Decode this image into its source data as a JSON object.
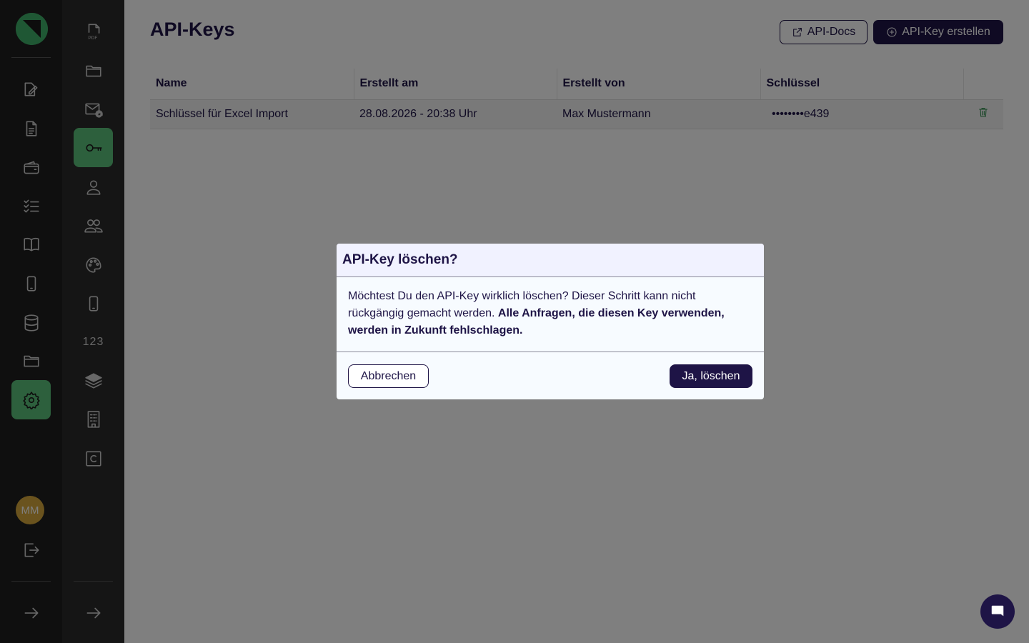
{
  "page": {
    "title": "API-Keys"
  },
  "header": {
    "docs_label": "API-Docs",
    "create_label": "API-Key erstellen"
  },
  "table": {
    "columns": [
      "Name",
      "Erstellt am",
      "Erstellt von",
      "Schlüssel"
    ],
    "rows": [
      {
        "name": "Schlüssel für Excel Import",
        "created_at": "28.08.2026 - 20:38 Uhr",
        "created_by": "Max Mustermann",
        "key": "••••••••e439"
      }
    ]
  },
  "sidebar": {
    "primary": [
      {
        "icon": "edit-document-icon"
      },
      {
        "icon": "document-icon"
      },
      {
        "icon": "wallet-icon"
      },
      {
        "icon": "checklist-icon"
      },
      {
        "icon": "book-icon"
      },
      {
        "icon": "phone-icon"
      },
      {
        "icon": "database-icon"
      },
      {
        "icon": "folder-icon"
      },
      {
        "icon": "settings-icon",
        "active": true
      }
    ],
    "secondary": [
      {
        "icon": "pdf-icon",
        "label": "PDF"
      },
      {
        "icon": "folder-icon"
      },
      {
        "icon": "mail-at-icon"
      },
      {
        "icon": "key-icon",
        "active": true
      },
      {
        "icon": "user-icon"
      },
      {
        "icon": "users-icon"
      },
      {
        "icon": "palette-icon"
      },
      {
        "icon": "mobile-icon"
      },
      {
        "icon": "numbers-icon",
        "label": "123"
      },
      {
        "icon": "layers-icon"
      },
      {
        "icon": "building-icon"
      },
      {
        "icon": "c-box-icon",
        "label": "C"
      }
    ],
    "avatar": "MM"
  },
  "modal": {
    "title": "API-Key löschen?",
    "body_plain": "Möchtest Du den API-Key wirklich löschen? Dieser Schritt kann nicht rückgängig gemacht werden.",
    "body_bold": "Alle Anfragen, die diesen Key verwenden, werden in Zukunft fehlschlagen.",
    "cancel_label": "Abbrechen",
    "confirm_label": "Ja, löschen"
  },
  "colors": {
    "accent": "#1e1446",
    "active_nav": "#5bc07a",
    "brand_green": "#3fae68"
  }
}
